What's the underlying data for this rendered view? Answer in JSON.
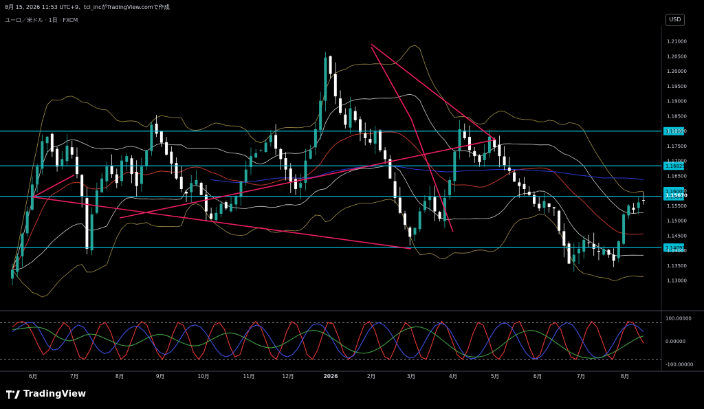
{
  "header": {
    "timestamp_line": "8月 15, 2026 11:53 UTC+9、tcl_incがTradingView.comで作成",
    "symbol_line": "ユーロ／米ドル · 1日 · FXCM",
    "currency_button": "USD"
  },
  "brand": {
    "name": "TradingView",
    "icon": "tradingview-logo-icon"
  },
  "colors": {
    "background": "#000000",
    "bull_candle": "#26a69a",
    "bear_candle": "#ffffff",
    "hline": "#00bcd4",
    "trendline": "#e91e63",
    "bb_outer": "#c8b45a",
    "bb_inner": "#ffffff",
    "ma_red": "#c0392b",
    "ma_blue": "#2a3bd6",
    "stoch_red": "#e53935",
    "stoch_blue": "#3f51e0",
    "stoch_green": "#43a047"
  },
  "chart_data": [
    {
      "type": "candlestick",
      "symbol": "EUR/USD",
      "timeframe": "1日",
      "source": "FXCM",
      "x": [
        "6月",
        "7月",
        "8月",
        "9月",
        "10月",
        "11月",
        "12月",
        "2026",
        "2月",
        "3月",
        "4月",
        "5月",
        "6月",
        "7月",
        "8月"
      ],
      "ylim": [
        1.12,
        1.215
      ],
      "y_ticks": [
        "1.21000",
        "1.20500",
        "1.20000",
        "1.19500",
        "1.19000",
        "1.18500",
        "1.18000",
        "1.17500",
        "1.17000",
        "1.16500",
        "1.16000",
        "1.15500",
        "1.15000",
        "1.14500",
        "1.14000",
        "1.13500",
        "1.13000"
      ],
      "horizontal_levels": [
        {
          "value": 1.17987,
          "label": "1.17987"
        },
        {
          "value": 1.16825,
          "label": "1.16825"
        },
        {
          "value": 1.15803,
          "label": "1.15803"
        },
        {
          "value": 1.14091,
          "label": "1.14091"
        }
      ],
      "last_price": {
        "value": 1.1567,
        "label": "1.15670"
      },
      "upper_label": {
        "value": 1.1598,
        "label": "1.16000"
      },
      "trendlines": [
        {
          "name": "",
          "points": [
            [
              "2月",
              1.209
            ],
            [
              "5月",
              1.177
            ],
            [
              "8月",
              1.1508
            ]
          ]
        },
        {
          "name": "",
          "points": [
            [
              "2月",
              1.208
            ],
            [
              "3月",
              1.184
            ],
            [
              "4月",
              1.1462
            ]
          ]
        },
        {
          "name": "",
          "points": [
            [
              "3月",
              1.1405
            ],
            [
              "6月",
              1.1578
            ],
            [
              "7月",
              1.1652
            ]
          ]
        }
      ],
      "closes": [
        1.1335,
        1.138,
        1.1455,
        1.153,
        1.162,
        1.168,
        1.1765,
        1.178,
        1.173,
        1.168,
        1.1705,
        1.175,
        1.172,
        1.1655,
        1.158,
        1.1405,
        1.152,
        1.16,
        1.164,
        1.168,
        1.1655,
        1.1625,
        1.17,
        1.1715,
        1.1655,
        1.1615,
        1.168,
        1.1735,
        1.182,
        1.179,
        1.176,
        1.172,
        1.169,
        1.164,
        1.1605,
        1.159,
        1.1625,
        1.1635,
        1.1585,
        1.153,
        1.1505,
        1.1525,
        1.1555,
        1.154,
        1.1555,
        1.158,
        1.163,
        1.167,
        1.1715,
        1.1725,
        1.1735,
        1.176,
        1.1785,
        1.174,
        1.1705,
        1.167,
        1.163,
        1.1605,
        1.1625,
        1.17,
        1.1735,
        1.1805,
        1.19,
        1.2045,
        1.199,
        1.1915,
        1.186,
        1.182,
        1.1875,
        1.1835,
        1.1795,
        1.1775,
        1.176,
        1.18,
        1.1735,
        1.1705,
        1.164,
        1.1575,
        1.1525,
        1.1485,
        1.1445,
        1.1475,
        1.153,
        1.1565,
        1.158,
        1.153,
        1.1505,
        1.1575,
        1.1635,
        1.173,
        1.1805,
        1.1775,
        1.1735,
        1.1715,
        1.1695,
        1.1725,
        1.178,
        1.1745,
        1.1715,
        1.1685,
        1.1665,
        1.163,
        1.1615,
        1.1605,
        1.1585,
        1.1555,
        1.154,
        1.1565,
        1.1545,
        1.154,
        1.1465,
        1.1415,
        1.1355,
        1.1385,
        1.1405,
        1.1435,
        1.1425,
        1.1405,
        1.1395,
        1.1405,
        1.1385,
        1.1365,
        1.143,
        1.152,
        1.155,
        1.1535,
        1.156,
        1.1567
      ],
      "bollinger": {
        "period": 20,
        "deviations": [
          1,
          2
        ]
      },
      "moving_averages": [
        {
          "period": 20
        },
        {
          "period": 200
        }
      ]
    },
    {
      "type": "line",
      "name": "stochastic",
      "ylim": [
        -120,
        120
      ],
      "y_ticks": [
        "100.00000",
        "0.00000",
        "-100.00000"
      ],
      "levels": [
        80,
        -80
      ],
      "series": [
        {
          "color": "#e53935",
          "values": [
            60,
            80,
            85,
            70,
            30,
            -20,
            -60,
            -40,
            10,
            50,
            80,
            60,
            -10,
            -70,
            -80,
            -40,
            20,
            70,
            80,
            40,
            -30,
            -80,
            -60,
            0,
            60,
            85,
            70,
            10,
            -50,
            -80,
            -40,
            30,
            80,
            70,
            20,
            -50,
            -80,
            -50,
            20,
            70,
            80,
            50,
            -20,
            -70,
            -60,
            10,
            60,
            85,
            60,
            0,
            -60,
            -80,
            -30,
            40,
            85,
            70,
            10,
            -60,
            -80,
            -40,
            30,
            80,
            75,
            20,
            -50,
            -80,
            -60,
            10,
            70,
            85,
            50,
            -20,
            -70,
            -80,
            -30,
            40,
            80,
            60,
            -10,
            -70,
            -80,
            -20,
            50,
            85,
            60,
            0,
            -60,
            -80,
            -40,
            30,
            80,
            70,
            10,
            -60,
            -80,
            -50,
            20,
            75,
            85,
            40,
            -30,
            -80,
            -60,
            10,
            70,
            80,
            50,
            -20,
            -70,
            -80,
            -20,
            50,
            85,
            60,
            0,
            -60,
            -80,
            -30,
            40,
            85,
            80,
            30,
            -10
          ]
        },
        {
          "color": "#3f51e0",
          "values": [
            40,
            55,
            70,
            80,
            80,
            60,
            20,
            -20,
            -40,
            -35,
            -10,
            25,
            55,
            70,
            60,
            30,
            -10,
            -40,
            -55,
            -50,
            -25,
            5,
            35,
            55,
            65,
            60,
            40,
            10,
            -25,
            -50,
            -60,
            -50,
            -25,
            10,
            45,
            65,
            70,
            60,
            35,
            0,
            -35,
            -60,
            -70,
            -60,
            -35,
            0,
            35,
            60,
            70,
            60,
            35,
            0,
            -35,
            -60,
            -70,
            -60,
            -35,
            5,
            45,
            70,
            75,
            65,
            35,
            0,
            -40,
            -65,
            -75,
            -65,
            -35,
            5,
            45,
            70,
            80,
            70,
            45,
            10,
            -30,
            -60,
            -75,
            -70,
            -45,
            -5,
            35,
            65,
            78,
            70,
            45,
            5,
            -35,
            -65,
            -78,
            -75,
            -55,
            -20,
            20,
            55,
            75,
            78,
            60,
            25,
            -20,
            -55,
            -75,
            -78,
            -65,
            -35,
            5,
            45,
            70,
            80,
            70,
            40,
            0,
            -40,
            -65,
            -75,
            -70,
            -50,
            -15,
            25,
            55,
            70,
            72,
            60,
            40
          ]
        },
        {
          "color": "#43a047",
          "values": [
            50,
            52,
            55,
            58,
            60,
            60,
            55,
            45,
            30,
            15,
            5,
            0,
            5,
            15,
            25,
            30,
            28,
            20,
            10,
            0,
            -10,
            -18,
            -22,
            -20,
            -12,
            0,
            12,
            22,
            28,
            28,
            22,
            12,
            0,
            -10,
            -18,
            -22,
            -20,
            -12,
            0,
            12,
            24,
            32,
            35,
            32,
            24,
            12,
            0,
            -12,
            -22,
            -28,
            -30,
            -26,
            -18,
            -6,
            8,
            22,
            34,
            42,
            46,
            44,
            36,
            24,
            10,
            -6,
            -22,
            -36,
            -46,
            -52,
            -54,
            -50,
            -42,
            -30,
            -14,
            4,
            22,
            38,
            50,
            58,
            62,
            60,
            52,
            40,
            24,
            6,
            -12,
            -30,
            -46,
            -58,
            -66,
            -70,
            -70,
            -66,
            -58,
            -46,
            -30,
            -12,
            6,
            22,
            34,
            42,
            46,
            44,
            36,
            24,
            10,
            -6,
            -22,
            -38,
            -52,
            -62,
            -70,
            -74,
            -76,
            -74,
            -70,
            -62,
            -52,
            -40,
            -26,
            -12,
            2,
            14,
            22
          ]
        }
      ]
    }
  ]
}
